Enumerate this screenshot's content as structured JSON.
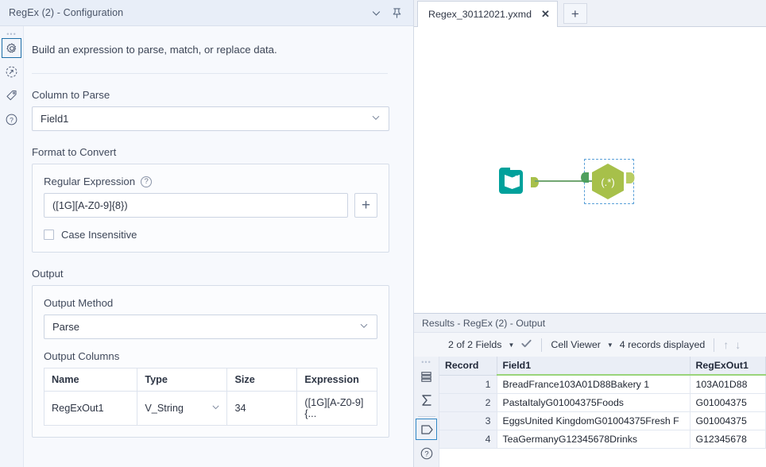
{
  "config": {
    "title": "RegEx (2) - Configuration",
    "titlebar_icons": [
      "chevron-down-icon",
      "pin-icon"
    ],
    "rail": [
      {
        "name": "gear-icon",
        "selected": true
      },
      {
        "name": "runtime-icon",
        "selected": false
      },
      {
        "name": "tag-icon",
        "selected": false
      },
      {
        "name": "help-icon",
        "selected": false
      }
    ],
    "description": "Build an expression to parse, match, or replace data.",
    "column_to_parse": {
      "label": "Column to Parse",
      "value": "Field1"
    },
    "format_to_convert": {
      "label": "Format to Convert",
      "regex_label": "Regular Expression",
      "regex_value": "([1G][A-Z0-9]{8})",
      "add_button": "+",
      "case_insensitive_label": "Case Insensitive",
      "case_insensitive_checked": false
    },
    "output": {
      "label": "Output",
      "method_label": "Output Method",
      "method_value": "Parse",
      "columns_label": "Output Columns",
      "headers": [
        "Name",
        "Type",
        "Size",
        "Expression"
      ],
      "rows": [
        {
          "name": "RegExOut1",
          "type": "V_String",
          "size": "34",
          "expression": "([1G][A-Z0-9]{..."
        }
      ]
    }
  },
  "workspace": {
    "tab_label": "Regex_30112021.yxmd",
    "tab_close": "✕",
    "new_tab": "+",
    "nodes": [
      {
        "name": "input-data-node",
        "tool": "Input Data",
        "color": "#00a19b"
      },
      {
        "name": "regex-node",
        "tool": "RegEx",
        "label": "(.*)",
        "color": "#a7c04a",
        "selected": true
      }
    ],
    "connector_color": "#71a671"
  },
  "results": {
    "title": "Results - RegEx (2) - Output",
    "toolbar": {
      "fields_label": "2 of 2 Fields",
      "check_icon": "check-icon",
      "viewer_label": "Cell Viewer",
      "records_label": "4 records displayed",
      "up_arrow": "↑",
      "down_arrow": "↓"
    },
    "rail": [
      {
        "name": "data-rows-icon",
        "selected": false
      },
      {
        "name": "sigma-icon",
        "selected": false
      },
      {
        "name": "output-shape-icon",
        "selected": true
      },
      {
        "name": "help-icon",
        "selected": false
      }
    ],
    "grid": {
      "headers": [
        "Record",
        "Field1",
        "RegExOut1"
      ],
      "rows": [
        {
          "record": "1",
          "field1": "BreadFrance103A01D88Bakery 1",
          "regexout1": "103A01D88"
        },
        {
          "record": "2",
          "field1": "PastaItalyG01004375Foods",
          "regexout1": "G01004375"
        },
        {
          "record": "3",
          "field1": "EggsUnited KingdomG01004375Fresh F",
          "regexout1": "G01004375"
        },
        {
          "record": "4",
          "field1": "TeaGermanyG12345678Drinks",
          "regexout1": "G12345678"
        }
      ]
    }
  },
  "colors": {
    "accent_green": "#9ad47a",
    "node_teal": "#00a19b",
    "node_olive": "#a7c04a",
    "selection_blue": "#5aa0d8"
  }
}
